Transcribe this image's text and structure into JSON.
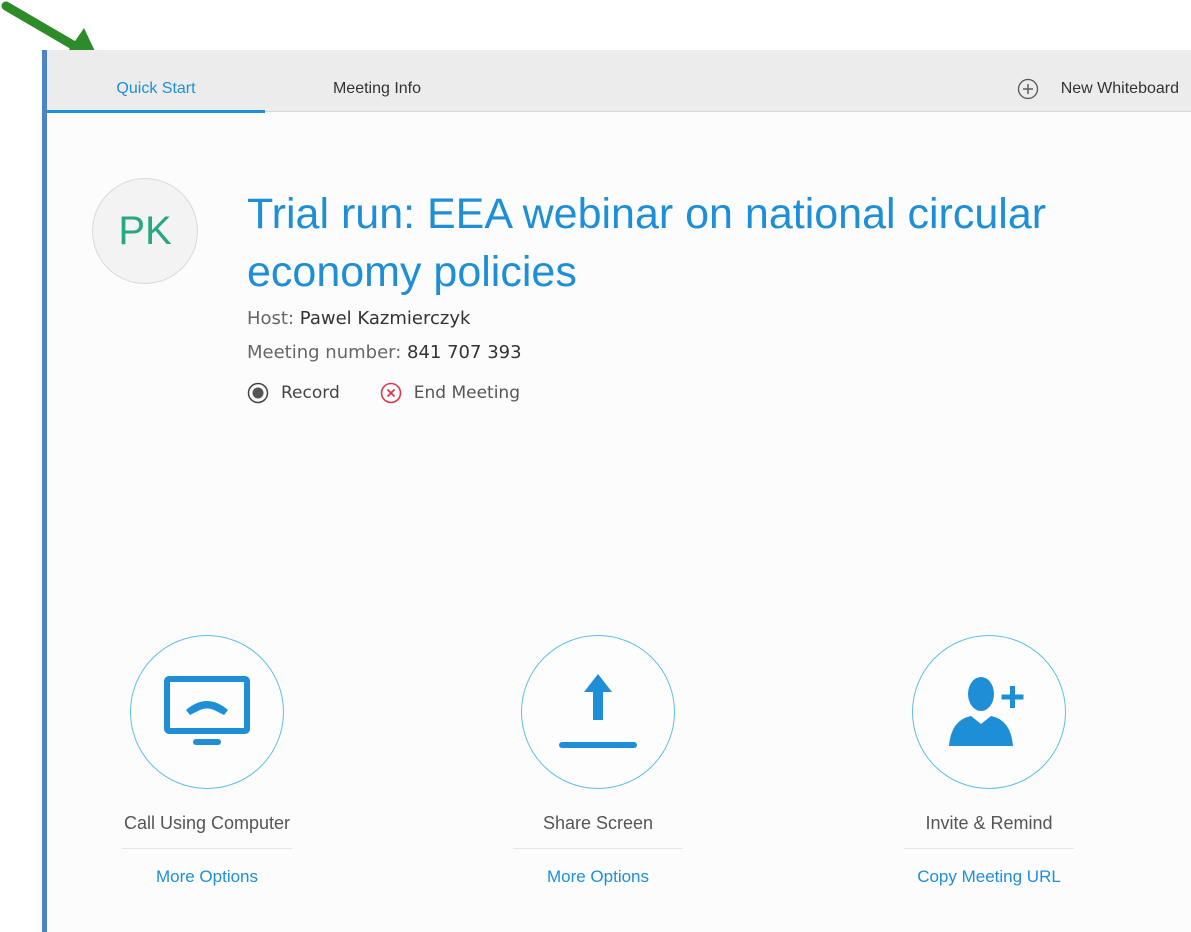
{
  "tabs": {
    "quick_start": "Quick Start",
    "meeting_info": "Meeting Info",
    "new_whiteboard": "New Whiteboard"
  },
  "meeting": {
    "initials": "PK",
    "title": "Trial run: EEA webinar on national circular economy policies",
    "host_label": "Host:",
    "host_name": "Pawel Kazmierczyk",
    "number_label": "Meeting number:",
    "number": "841 707 393",
    "record_label": "Record",
    "end_label": "End Meeting"
  },
  "tools": [
    {
      "label": "Call Using Computer",
      "link": "More Options",
      "icon": "computer-call-icon"
    },
    {
      "label": "Share Screen",
      "link": "More Options",
      "icon": "share-upload-icon"
    },
    {
      "label": "Invite & Remind",
      "link": "Copy Meeting URL",
      "icon": "add-person-icon"
    }
  ],
  "colors": {
    "accent": "#1e8fd6",
    "initials": "#27a882",
    "end_meeting": "#e0344b",
    "annotation_arrow": "#2e8b2a"
  }
}
